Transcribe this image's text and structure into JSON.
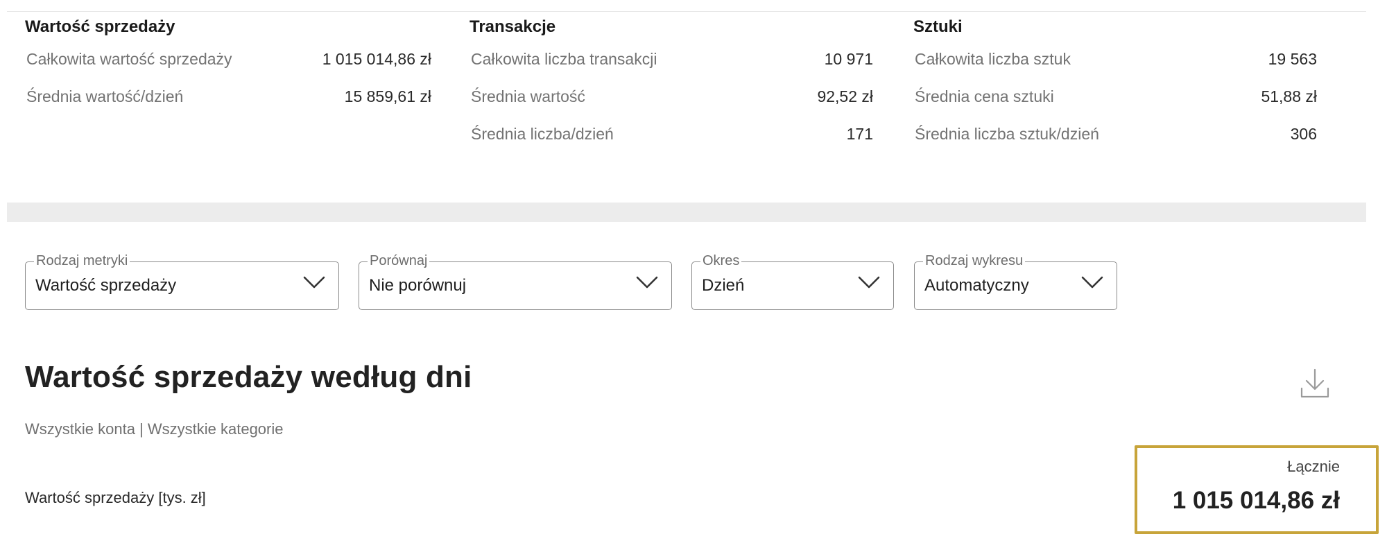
{
  "stats": {
    "sales": {
      "title": "Wartość sprzedaży",
      "rows": [
        {
          "label": "Całkowita wartość sprzedaży",
          "value": "1 015 014,86 zł"
        },
        {
          "label": "Średnia wartość/dzień",
          "value": "15 859,61 zł"
        }
      ]
    },
    "transactions": {
      "title": "Transakcje",
      "rows": [
        {
          "label": "Całkowita liczba transakcji",
          "value": "10 971"
        },
        {
          "label": "Średnia wartość",
          "value": "92,52 zł"
        },
        {
          "label": "Średnia liczba/dzień",
          "value": "171"
        }
      ]
    },
    "units": {
      "title": "Sztuki",
      "rows": [
        {
          "label": "Całkowita liczba sztuk",
          "value": "19 563"
        },
        {
          "label": "Średnia cena sztuki",
          "value": "51,88 zł"
        },
        {
          "label": "Średnia liczba sztuk/dzień",
          "value": "306"
        }
      ]
    }
  },
  "filters": {
    "metric": {
      "label": "Rodzaj metryki",
      "value": "Wartość sprzedaży"
    },
    "compare": {
      "label": "Porównaj",
      "value": "Nie porównuj"
    },
    "period": {
      "label": "Okres",
      "value": "Dzień"
    },
    "chart_type": {
      "label": "Rodzaj wykresu",
      "value": "Automatyczny"
    }
  },
  "chart": {
    "title": "Wartość sprzedaży według dni",
    "subtitle": "Wszystkie konta | Wszystkie kategorie",
    "y_label": "Wartość sprzedaży [tys. zł]",
    "download_icon": "download-icon",
    "total": {
      "label": "Łącznie",
      "value": "1 015 014,86 zł"
    }
  },
  "colors": {
    "highlight_border": "#c7a43a",
    "band": "#ececec",
    "field_border": "#8a8a8a"
  }
}
